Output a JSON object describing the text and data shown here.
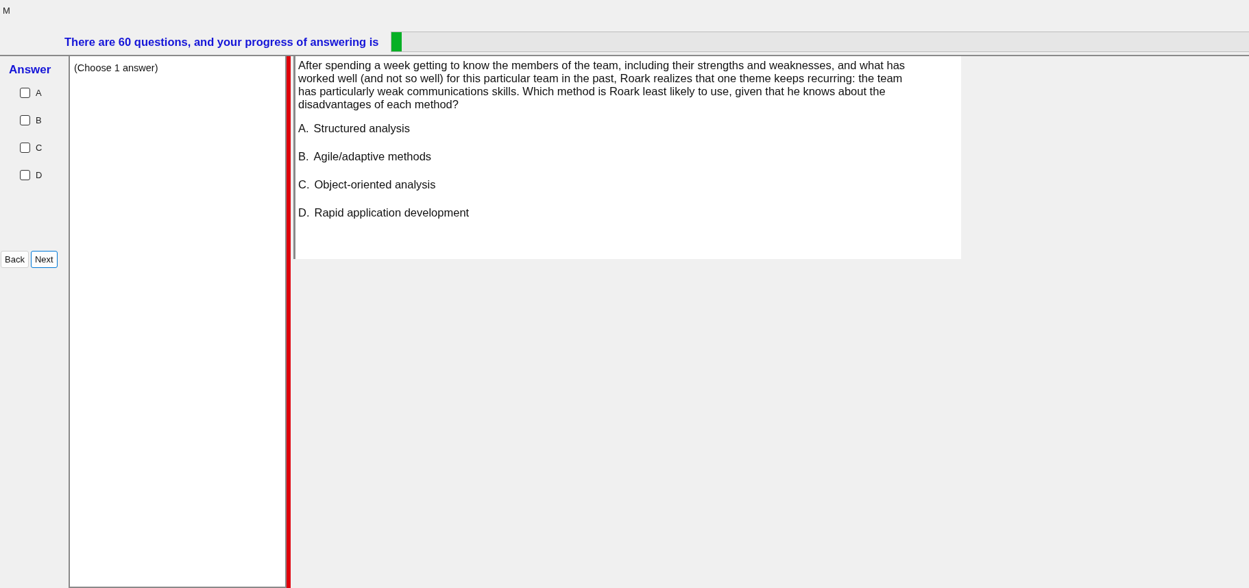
{
  "window": {
    "title": "M"
  },
  "progress": {
    "label": "There are 60 questions, and your progress of answering is",
    "level": 0.012
  },
  "answer": {
    "heading": "Answer",
    "options": [
      {
        "label": "A",
        "checked": false
      },
      {
        "label": "B",
        "checked": false
      },
      {
        "label": "C",
        "checked": false
      },
      {
        "label": "D",
        "checked": false
      }
    ]
  },
  "buttons": [
    {
      "label": "Back",
      "selected": false
    },
    {
      "label": "Next",
      "selected": true
    }
  ],
  "instruction": "(Choose 1 answer)",
  "question": {
    "text": "After spending a week getting to know the members of the team, including their strengths and weaknesses, and what has worked well (and not so well) for this particular team in the past, Roark realizes that one theme keeps recurring: the team has particularly weak communications skills. Which method is Roark least likely to use, given that he knows about the disadvantages of each method?",
    "choices": [
      {
        "letter": "A.",
        "text": "Structured analysis"
      },
      {
        "letter": "B.",
        "text": "Agile/adaptive methods"
      },
      {
        "letter": "C.",
        "text": "Object-oriented analysis"
      },
      {
        "letter": "D.",
        "text": "Rapid application development"
      }
    ]
  }
}
